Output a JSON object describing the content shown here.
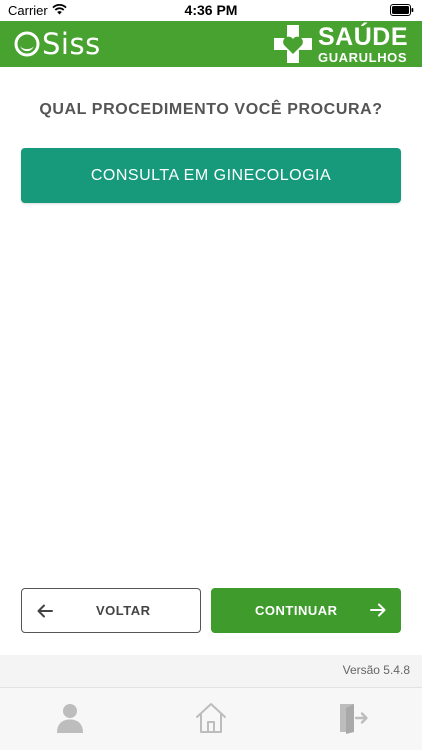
{
  "status_bar": {
    "carrier": "Carrier",
    "time": "4:36 PM",
    "icons": [
      "wifi-icon",
      "battery-icon"
    ]
  },
  "header": {
    "app_name": "Siss",
    "brand": {
      "line1": "SAÚDE",
      "line2": "GUARULHOS"
    },
    "color": "#47a22f"
  },
  "main": {
    "question": "QUAL PROCEDIMENTO VOCÊ PROCURA?",
    "procedures": [
      {
        "label": "CONSULTA EM GINECOLOGIA",
        "color": "#179a7c"
      }
    ]
  },
  "actions": {
    "back_label": "VOLTAR",
    "continue_label": "CONTINUAR",
    "continue_color": "#3f9c2c"
  },
  "footer": {
    "version": "Versão 5.4.8"
  },
  "tab_bar": {
    "items": [
      {
        "icon": "user-icon"
      },
      {
        "icon": "home-icon"
      },
      {
        "icon": "exit-door-icon"
      }
    ]
  }
}
